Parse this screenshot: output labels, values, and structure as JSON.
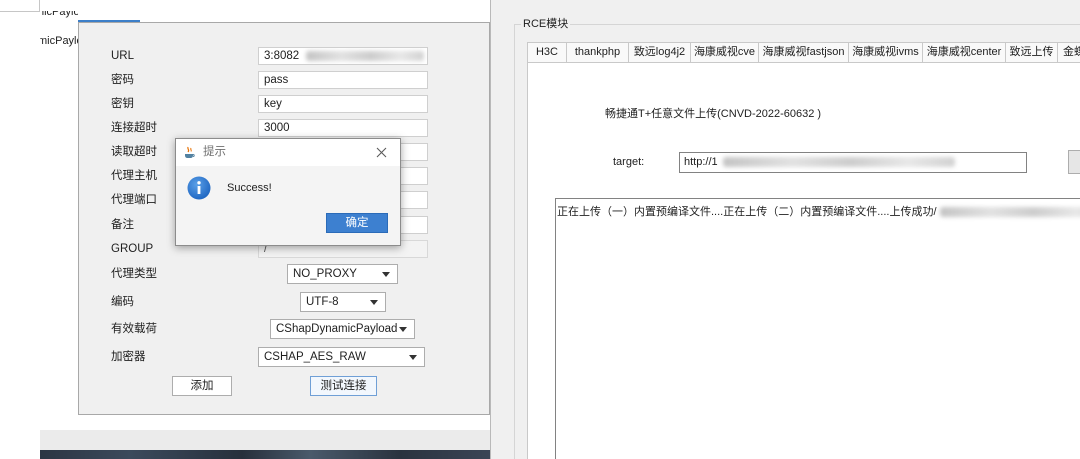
{
  "background_window": {
    "lines": [
      "nicPaylo",
      "micPaylo"
    ]
  },
  "shell_form": {
    "fields": [
      {
        "label": "URL",
        "value": "3:8082"
      },
      {
        "label": "密码",
        "value": "pass"
      },
      {
        "label": "密钥",
        "value": "key"
      },
      {
        "label": "连接超时",
        "value": "3000"
      },
      {
        "label": "读取超时"
      },
      {
        "label": "代理主机"
      },
      {
        "label": "代理端口"
      },
      {
        "label": "备注"
      },
      {
        "label": "GROUP",
        "value": "/"
      }
    ],
    "selects": [
      {
        "label": "代理类型",
        "value": "NO_PROXY"
      },
      {
        "label": "编码",
        "value": "UTF-8"
      },
      {
        "label": "有效载荷",
        "value": "CShapDynamicPayload"
      },
      {
        "label": "加密器",
        "value": "CSHAP_AES_RAW"
      }
    ],
    "add_button": "添加",
    "test_connection_button": "测试连接"
  },
  "message_box": {
    "title": "提示",
    "message": "Success!",
    "ok_button": "确定"
  },
  "rce_panel": {
    "title": "RCE模块",
    "tabs": [
      "H3C",
      "thankphp",
      "致远log4j2",
      "海康威视cve",
      "海康威视fastjson",
      "海康威视ivms",
      "海康威视center",
      "致远上传",
      "金蝶"
    ],
    "exploit_title": "畅捷通T+任意文件上传(CNVD-2022-60632 )",
    "target_label": "target:",
    "target_value": "http://1",
    "output_text": "正在上传（一）内置预编译文件....正在上传（二）内置预编译文件....上传成功/"
  },
  "icons": {
    "message_box_app": "java-app-icon",
    "message_box_type": "info-icon",
    "message_box_close": "close-icon",
    "select_dropdown": "chevron-down-icon"
  },
  "colors": {
    "accent": "#3c7fc9",
    "ok_button": "#3d80d0",
    "info_icon": "#1d64c0",
    "window_background": "#f0f0f0"
  }
}
